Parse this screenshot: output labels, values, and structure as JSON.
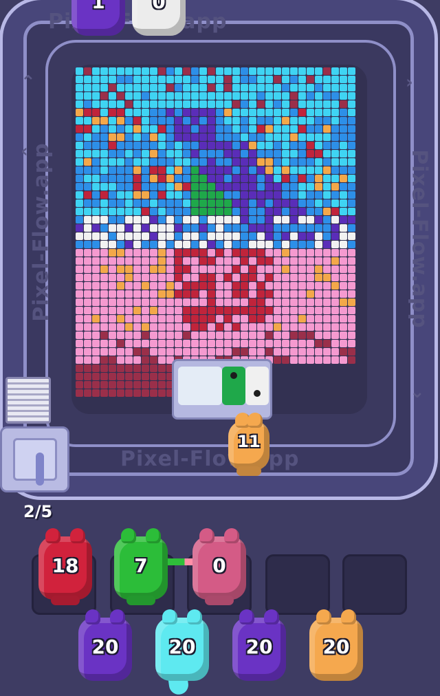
{
  "watermark": "Pixel-Flow.app",
  "level_progress": "2/5",
  "colors": {
    "cyan": "#3fd4f3",
    "blue": "#2d8fe8",
    "purple": "#5a2db8",
    "green": "#1fa84a",
    "red": "#c0243b",
    "maroon": "#9a2f4a",
    "pink": "#f59ad0",
    "white": "#f2f2f2",
    "orange": "#f3a84a"
  },
  "top_shooters": [
    {
      "color": "#6a33c4",
      "count": "1",
      "icon": "purple-pig"
    },
    {
      "color": "#ececec",
      "count": "0",
      "icon": "white-pig"
    }
  ],
  "belt_shooter": {
    "color": "#f5a84e",
    "count": "11",
    "icon": "orange-pig"
  },
  "active_slots": [
    {
      "color": "#d1223c",
      "count": "18",
      "icon": "red-pig"
    },
    {
      "color": "#2cbd39",
      "count": "7",
      "icon": "green-pig"
    },
    {
      "color": "#d45b86",
      "count": "0",
      "icon": "pink-pig"
    }
  ],
  "queue": [
    {
      "color": "#6a33c4",
      "count": "20",
      "icon": "purple-pig"
    },
    {
      "color": "#5ee9f0",
      "count": "20",
      "icon": "cyan-pig"
    },
    {
      "color": "#6a33c4",
      "count": "20",
      "icon": "purple-pig"
    },
    {
      "color": "#f5a84e",
      "count": "20",
      "icon": "orange-pig"
    }
  ]
}
